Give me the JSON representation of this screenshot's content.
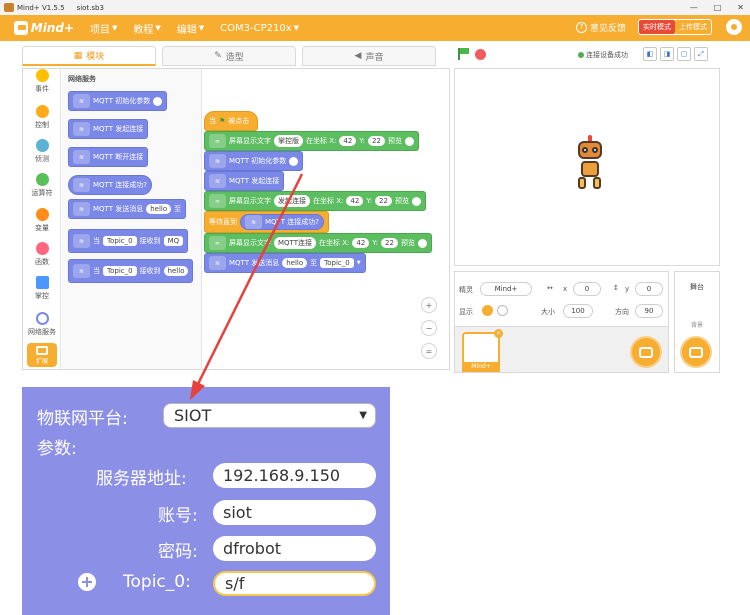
{
  "window": {
    "app_version": "Mind+ V1.5.5",
    "file_name": "siot.sb3",
    "controls": [
      "—",
      "□",
      "✕"
    ]
  },
  "menubar": {
    "logo_text": "Mind+",
    "items": [
      "项目",
      "教程",
      "编辑",
      "COM3-CP210x"
    ],
    "help_label": "意见反馈",
    "mode_realtime": "实时模式",
    "mode_upload": "上传模式"
  },
  "tabs": [
    "模块",
    "造型",
    "声音"
  ],
  "status": {
    "connection": "连接设备成功"
  },
  "categories": [
    {
      "label": "事件",
      "color": "#ffbf00"
    },
    {
      "label": "控制",
      "color": "#ffab19"
    },
    {
      "label": "侦测",
      "color": "#5cb1d6"
    },
    {
      "label": "运算符",
      "color": "#59c059"
    },
    {
      "label": "变量",
      "color": "#ff8c1a"
    },
    {
      "label": "函数",
      "color": "#ff6680"
    },
    {
      "label": "掌控",
      "color": "#4c97ff"
    },
    {
      "label": "网络服务",
      "color": "#7b88e7"
    }
  ],
  "extension_label": "扩展",
  "palette": {
    "title": "网络服务",
    "blocks": {
      "mqtt_init": "MQTT 初始化参数",
      "mqtt_connect": "MQTT 发起连接",
      "mqtt_disconnect": "MQTT 断开连接",
      "mqtt_connected": "MQTT 连接成功?",
      "mqtt_send": "MQTT 发送消息",
      "send_msg": "hello",
      "send_to": "至",
      "when_prefix": "当",
      "topic": "Topic_0",
      "receive": "接收到",
      "recv_trunc": "MQ",
      "recv_msg": "hello"
    }
  },
  "script": {
    "hat_prefix": "当",
    "hat_suffix": "被点击",
    "display_prefix": "屏幕显示文字",
    "at_coords": "在坐标 X:",
    "y_label": "Y:",
    "x_val": "42",
    "y_val": "22",
    "preview": "预览",
    "text1": "掌控版",
    "text2": "发起连接",
    "text3": "MQTT连接",
    "wait_label": "等待直到",
    "mqtt_init": "MQTT 初始化参数",
    "mqtt_connect": "MQTT 发起连接",
    "mqtt_connected": "MQTT 连接成功?",
    "mqtt_send": "MQTT 发送消息",
    "send_msg": "hello",
    "send_to": "至",
    "topic": "Topic_0"
  },
  "zoom_controls": [
    "+",
    "−",
    "="
  ],
  "sprite_props": {
    "sprite_label": "精灵",
    "sprite_name": "Mind+",
    "x_label": "x",
    "x_val": "0",
    "y_label": "y",
    "y_val": "0",
    "show_label": "显示",
    "size_label": "大小",
    "size_val": "100",
    "direction_label": "方向",
    "direction_val": "90"
  },
  "sprite_thumb_label": "Mind+",
  "stage_panel": {
    "title": "舞台",
    "backdrop_label": "背景"
  },
  "settings": {
    "platform_label": "物联网平台:",
    "platform_value": "SIOT",
    "params_label": "参数:",
    "server_label": "服务器地址:",
    "server_value": "192.168.9.150",
    "account_label": "账号:",
    "account_value": "siot",
    "password_label": "密码:",
    "password_value": "dfrobot",
    "topic_label": "Topic_0:",
    "topic_value": "s/f"
  },
  "colors": {
    "accent": "#f6ad30",
    "network_block": "#7b88e7",
    "display_block": "#5dbd61",
    "arrow": "#e8403a",
    "panel": "#8c8fe6"
  }
}
